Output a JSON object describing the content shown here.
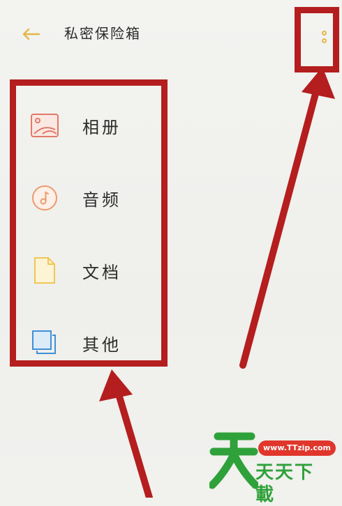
{
  "header": {
    "title": "私密保险箱",
    "back_icon": "arrow-left-icon",
    "more_icon": "more-vertical-icon"
  },
  "categories": [
    {
      "label": "相册",
      "icon": "photo-album-icon",
      "color": "#e07a68"
    },
    {
      "label": "音频",
      "icon": "music-note-icon",
      "color": "#ec9a6c"
    },
    {
      "label": "文档",
      "icon": "document-icon",
      "color": "#f0c654"
    },
    {
      "label": "其他",
      "icon": "stacked-squares-icon",
      "color": "#3f8fd6"
    }
  ],
  "colors": {
    "accent_yellow": "#e4b74a",
    "annotation_red": "#b41e1e"
  },
  "watermark": {
    "url": "www.TTzip.com",
    "name": "天天下載"
  }
}
